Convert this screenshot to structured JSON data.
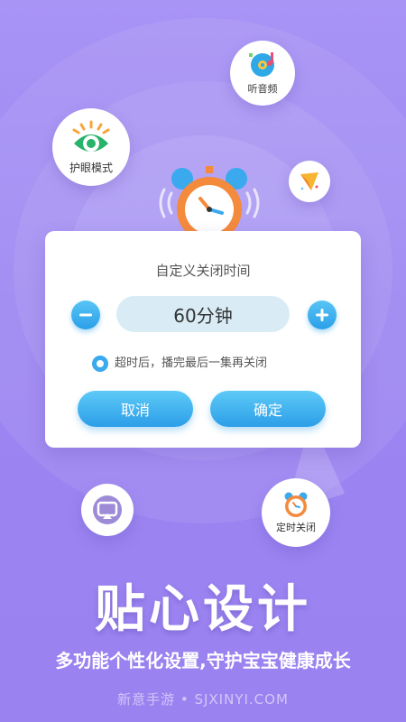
{
  "features": {
    "eye_mode": "护眼模式",
    "listen_audio": "听音频",
    "timer_close": "定时关闭"
  },
  "dialog": {
    "title": "自定义关闭时间",
    "value": "60分钟",
    "option": "超时后，播完最后一集再关闭",
    "cancel": "取消",
    "confirm": "确定"
  },
  "headline": "贴心设计",
  "subline": "多功能个性化设置,守护宝宝健康成长",
  "watermark": "新意手游 • SJXINYI.COM",
  "colors": {
    "background": "#9c86f2",
    "accent_blue": "#2c9ee8",
    "alarm_orange": "#f48a3c",
    "eye_green": "#27b36a"
  }
}
